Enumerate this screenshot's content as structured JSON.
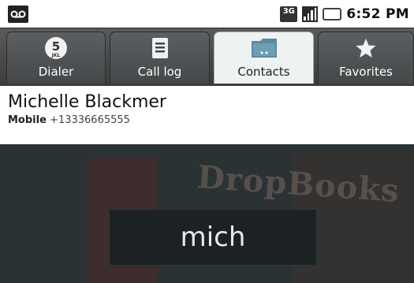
{
  "status_bar": {
    "network": "3G",
    "time": "6:52 PM"
  },
  "tabs": [
    {
      "label": "Dialer",
      "icon": "dialpad-5-jkl-icon",
      "dial_digit": "5",
      "dial_letters": "JKL",
      "active": false
    },
    {
      "label": "Call log",
      "icon": "call-log-icon",
      "active": false
    },
    {
      "label": "Contacts",
      "icon": "contacts-folder-icon",
      "active": true
    },
    {
      "label": "Favorites",
      "icon": "star-icon",
      "active": false
    }
  ],
  "contact": {
    "name": "Michelle Blackmer",
    "phone_type": "Mobile",
    "phone_number": "+13336665555"
  },
  "filter": {
    "text": "mich"
  },
  "watermark": "DropBooks"
}
